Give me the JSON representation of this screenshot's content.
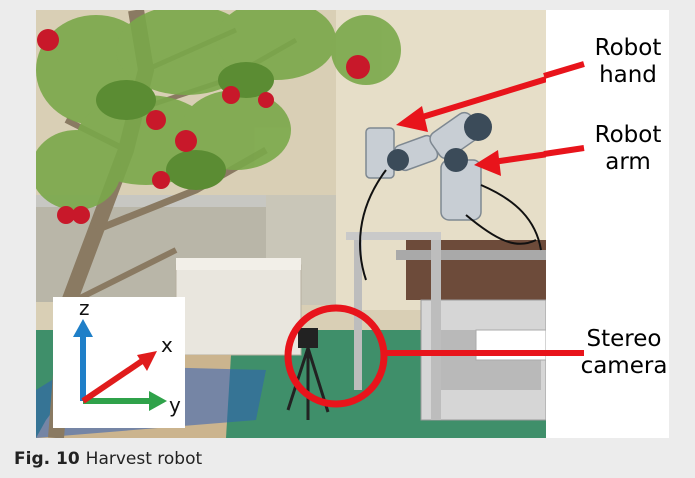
{
  "labels": {
    "robot_hand": [
      "Robot",
      "hand"
    ],
    "robot_arm": [
      "Robot",
      "arm"
    ],
    "stereo_camera": [
      "Stereo",
      "camera"
    ]
  },
  "axes": {
    "z": "z",
    "x": "x",
    "y": "y"
  },
  "caption": {
    "label": "Fig. 10",
    "text": "Harvest robot"
  },
  "colors": {
    "annotation_red": "#e8141b",
    "z_axis": "#1f7fc8",
    "x_axis": "#e01c1c",
    "y_axis": "#2fa24a"
  }
}
